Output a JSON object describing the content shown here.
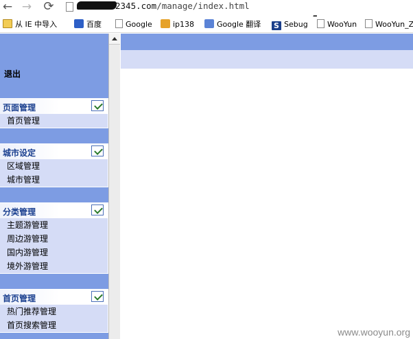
{
  "browser": {
    "url_host": "2345.com",
    "url_path": "/manage/index.html",
    "icons": {
      "back": "←",
      "forward": "→",
      "reload": "⟳",
      "cursor": "↖"
    }
  },
  "bookmarks": [
    {
      "label": "从 IE 中导入",
      "icon": "folder-icon"
    },
    {
      "label": "百度",
      "icon": "paw-icon"
    },
    {
      "label": "Google",
      "icon": "page-icon"
    },
    {
      "label": "ip138",
      "icon": "ip-icon"
    },
    {
      "label": "Google 翻译",
      "icon": "translate-icon"
    },
    {
      "label": "Sebug",
      "icon": "s-icon",
      "glyph": "S"
    },
    {
      "label": "WooYun",
      "icon": "page-icon"
    },
    {
      "label": "WooYun_Zo",
      "icon": "page-icon"
    }
  ],
  "sidebar": {
    "logout": "退出",
    "groups": [
      {
        "title": "页面管理",
        "items": [
          "首页管理"
        ]
      },
      {
        "title": "城市设定",
        "items": [
          "区域管理",
          "城市管理"
        ]
      },
      {
        "title": "分类管理",
        "items": [
          "主题游管理",
          "周边游管理",
          "国内游管理",
          "境外游管理"
        ]
      },
      {
        "title": "首页管理",
        "items": [
          "热门推荐管理",
          "首页搜索管理"
        ]
      }
    ]
  },
  "watermark": "www.wooyun.org",
  "colors": {
    "sidebar": "#7d9ce3",
    "panel": "#d5dcf6",
    "title": "#1a3f8f"
  }
}
